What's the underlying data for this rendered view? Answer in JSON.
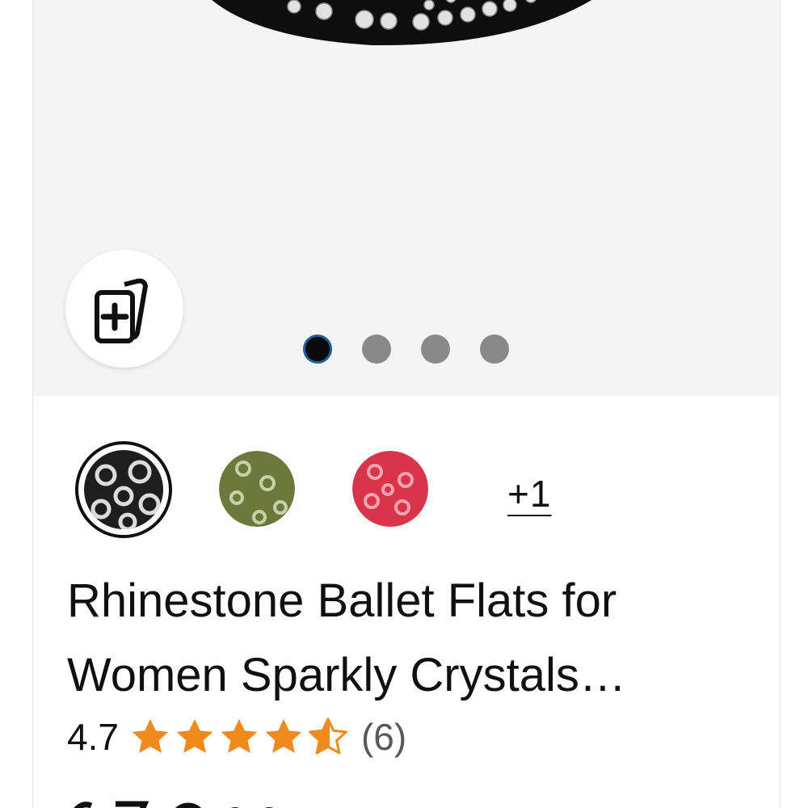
{
  "gallery": {
    "compare_icon": "add-to-compare-icon",
    "image_count": 4,
    "active_index": 0
  },
  "swatches": {
    "items": [
      {
        "name": "black-swatch",
        "color": "#1e1e1e",
        "selected": true
      },
      {
        "name": "olive-swatch",
        "color": "#6b7a3c",
        "selected": false
      },
      {
        "name": "red-swatch",
        "color": "#d9344a",
        "selected": false
      }
    ],
    "more_label": "+1"
  },
  "product": {
    "title_line1": "Rhinestone Ballet Flats for",
    "title_line2": "Women Sparkly Crystals…",
    "rating": "4.7",
    "rating_value": 4.7,
    "review_count": "(6)"
  },
  "colors": {
    "star": "#f08a1d",
    "active_dot": "#0a0a0a",
    "inactive_dot": "#898989"
  }
}
